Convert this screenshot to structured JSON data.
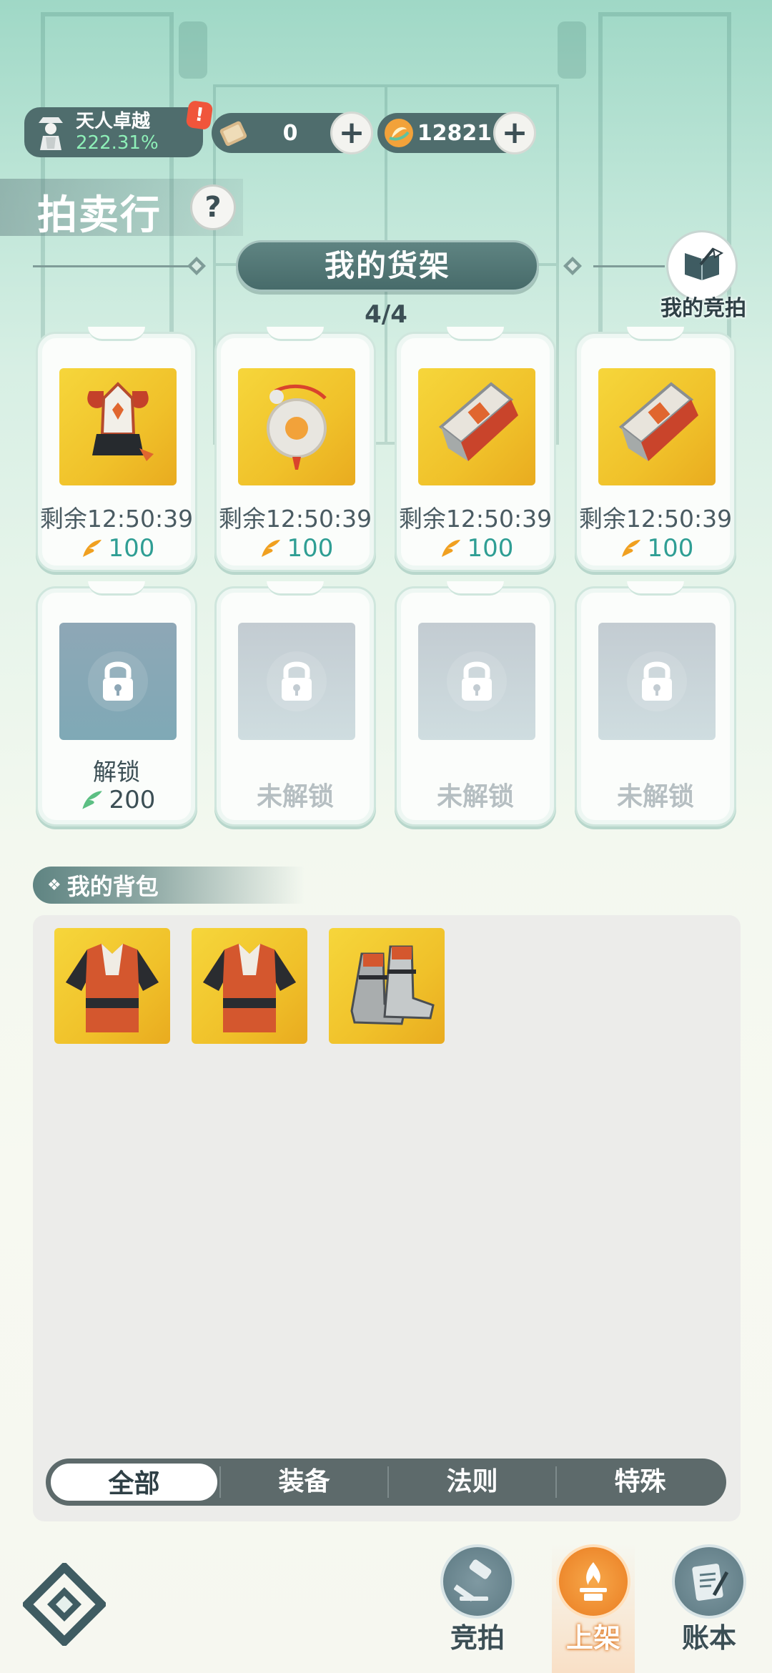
{
  "status_bar": {
    "rank_title": "天人卓越",
    "rank_percent": "222.31%",
    "alert_mark": "!",
    "currency_1": {
      "icon": "scroll-ticket-icon",
      "value": "0"
    },
    "currency_2": {
      "icon": "jade-coin-icon",
      "value": "12821"
    },
    "plus_label": "+"
  },
  "header": {
    "title": "拍卖行",
    "help_label": "?",
    "shelf_title": "我的货架",
    "shelf_count": "4/4",
    "my_bids_label": "我的竞拍"
  },
  "shelf": {
    "listed": [
      {
        "item": "crown-helmet-icon",
        "timer": "剩余12:50:39",
        "price": "100"
      },
      {
        "item": "jade-pendant-icon",
        "timer": "剩余12:50:39",
        "price": "100"
      },
      {
        "item": "bracer-icon",
        "timer": "剩余12:50:39",
        "price": "100"
      },
      {
        "item": "bracer-icon",
        "timer": "剩余12:50:39",
        "price": "100"
      }
    ],
    "unlock_slot": {
      "label": "解锁",
      "price": "200"
    },
    "locked_slots": [
      {
        "label": "未解锁"
      },
      {
        "label": "未解锁"
      },
      {
        "label": "未解锁"
      }
    ]
  },
  "bag": {
    "title": "我的背包",
    "items": [
      "robe-armor-icon",
      "robe-armor-icon",
      "boots-icon"
    ],
    "filters": [
      "全部",
      "装备",
      "法则",
      "特殊"
    ],
    "selected_filter": "全部"
  },
  "bottom_nav": {
    "items": [
      {
        "label": "竞拍",
        "icon": "gavel-icon"
      },
      {
        "label": "上架",
        "icon": "flame-stand-icon"
      },
      {
        "label": "账本",
        "icon": "ledger-icon"
      }
    ],
    "active": "上架"
  },
  "colors": {
    "accent_teal": "#2f9e94",
    "pill_bg": "#4f6d6d",
    "item_gold": "#f0c12a",
    "active_nav": "#f08a2a"
  }
}
